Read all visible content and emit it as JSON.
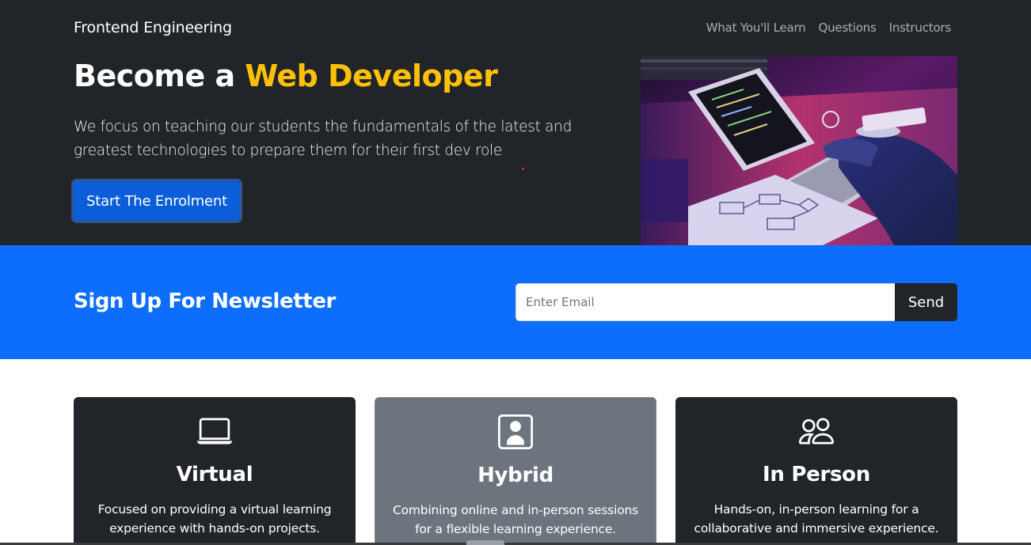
{
  "navbar": {
    "brand": "Frontend Engineering",
    "links": [
      "What You'll Learn",
      "Questions",
      "Instructors"
    ]
  },
  "hero": {
    "title_prefix": "Become a",
    "title_accent": "Web Developer",
    "text": "We focus on teaching our students the fundamentals of the latest and greatest technologies to prepare them for their first dev role",
    "cta_label": "Start The Enrolment",
    "accent_color": "#ffc107"
  },
  "newsletter": {
    "title": "Sign Up For Newsletter",
    "email_placeholder": "Enter Email",
    "email_value": "",
    "send_label": "Send",
    "background": "#0d6efd"
  },
  "cards": [
    {
      "icon": "laptop-icon",
      "title": "Virtual",
      "text": "Focused on providing a virtual learning experience with hands-on projects.",
      "background": "#212529"
    },
    {
      "icon": "person-badge-icon",
      "title": "Hybrid",
      "text": "Combining online and in-person sessions for a flexible learning experience.",
      "background": "#6c757d"
    },
    {
      "icon": "people-icon",
      "title": "In Person",
      "text": "Hands-on, in-person learning for a collaborative and immersive experience.",
      "background": "#212529"
    }
  ]
}
